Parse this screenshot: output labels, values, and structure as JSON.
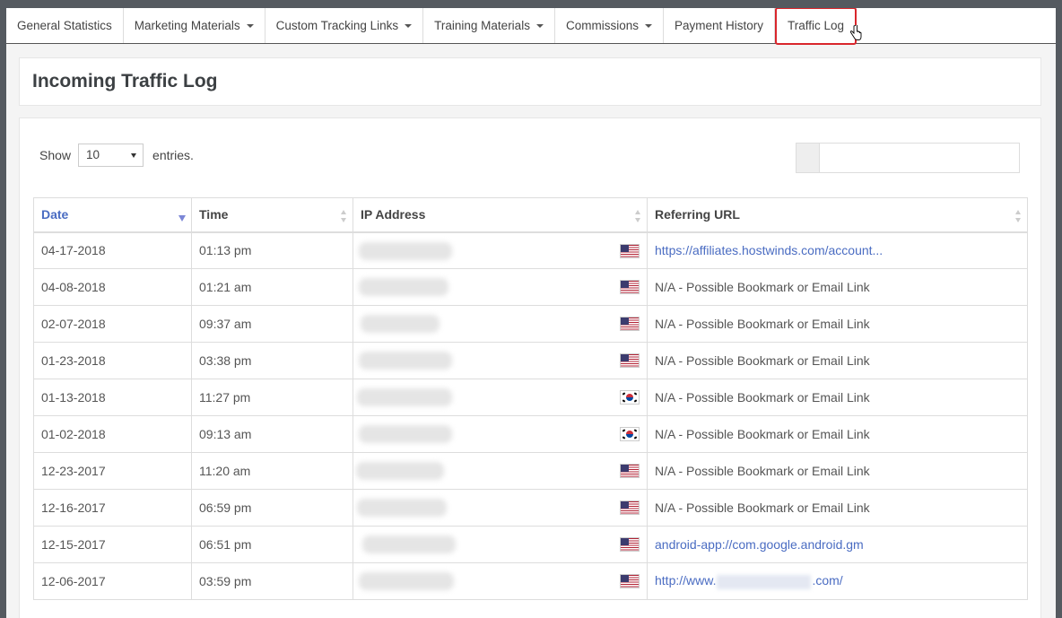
{
  "nav": {
    "tabs": [
      {
        "label": "General Statistics",
        "dropdown": false,
        "active": false
      },
      {
        "label": "Marketing Materials",
        "dropdown": true,
        "active": false
      },
      {
        "label": "Custom Tracking Links",
        "dropdown": true,
        "active": false
      },
      {
        "label": "Training Materials",
        "dropdown": true,
        "active": false
      },
      {
        "label": "Commissions",
        "dropdown": true,
        "active": false
      },
      {
        "label": "Payment History",
        "dropdown": false,
        "active": false
      },
      {
        "label": "Traffic Log",
        "dropdown": false,
        "active": true
      }
    ]
  },
  "page": {
    "title": "Incoming Traffic Log"
  },
  "controls": {
    "show_label": "Show",
    "entries_value": "10",
    "entries_suffix": "entries."
  },
  "table": {
    "columns": [
      "Date",
      "Time",
      "IP Address",
      "Referring URL"
    ],
    "sorted_column": "Date",
    "rows": [
      {
        "date": "04-17-2018",
        "time": "01:13 pm",
        "flag": "us-flag",
        "url": "https://affiliates.hostwinds.com/account...",
        "url_is_link": true
      },
      {
        "date": "04-08-2018",
        "time": "01:21 am",
        "flag": "us-flag",
        "url": "N/A - Possible Bookmark or Email Link",
        "url_is_link": false
      },
      {
        "date": "02-07-2018",
        "time": "09:37 am",
        "flag": "us-flag",
        "url": "N/A - Possible Bookmark or Email Link",
        "url_is_link": false
      },
      {
        "date": "01-23-2018",
        "time": "03:38 pm",
        "flag": "us-flag",
        "url": "N/A - Possible Bookmark or Email Link",
        "url_is_link": false
      },
      {
        "date": "01-13-2018",
        "time": "11:27 pm",
        "flag": "kr-flag",
        "url": "N/A - Possible Bookmark or Email Link",
        "url_is_link": false
      },
      {
        "date": "01-02-2018",
        "time": "09:13 am",
        "flag": "kr-flag",
        "url": "N/A - Possible Bookmark or Email Link",
        "url_is_link": false
      },
      {
        "date": "12-23-2017",
        "time": "11:20 am",
        "flag": "us-flag",
        "url": "N/A - Possible Bookmark or Email Link",
        "url_is_link": false
      },
      {
        "date": "12-16-2017",
        "time": "06:59 pm",
        "flag": "us-flag",
        "url": "N/A - Possible Bookmark or Email Link",
        "url_is_link": false
      },
      {
        "date": "12-15-2017",
        "time": "06:51 pm",
        "flag": "us-flag",
        "url": "android-app://com.google.android.gm",
        "url_is_link": true
      },
      {
        "date": "12-06-2017",
        "time": "03:59 pm",
        "flag": "us-flag",
        "url_prefix": "http://www.",
        "url_suffix": ".com/",
        "url_is_link": true,
        "url_redacted": true
      }
    ]
  },
  "colors": {
    "accent": "#4a6cc2",
    "active_outline": "#d9262c"
  }
}
